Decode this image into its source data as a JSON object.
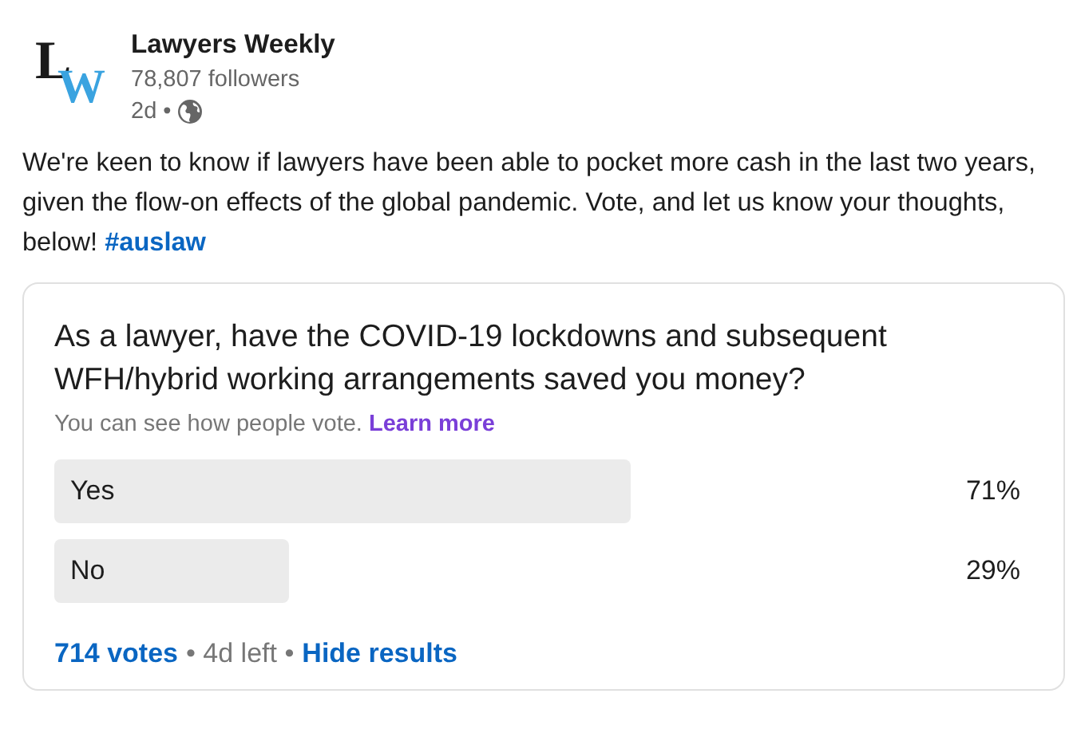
{
  "author": {
    "logo": {
      "first": "L",
      "second": "W"
    },
    "name": "Lawyers Weekly",
    "followers": "78,807 followers",
    "age": "2d •"
  },
  "post": {
    "text": "We're keen to know if lawyers have been able to pocket more cash in the last two years, given the flow-on effects of the global pandemic. Vote, and let us know your thoughts, below!",
    "hashtag": "#auslaw"
  },
  "poll": {
    "question": "As a lawyer, have the COVID-19 lockdowns and subsequent WFH/hybrid working arrangements saved you money?",
    "note": "You can see how people vote.",
    "note_link": "Learn more",
    "options": [
      {
        "label": "Yes",
        "percent": "71%"
      },
      {
        "label": "No",
        "percent": "29%"
      }
    ],
    "votes": "714 votes",
    "time_left": "• 4d left •",
    "hide": "Hide results"
  }
}
